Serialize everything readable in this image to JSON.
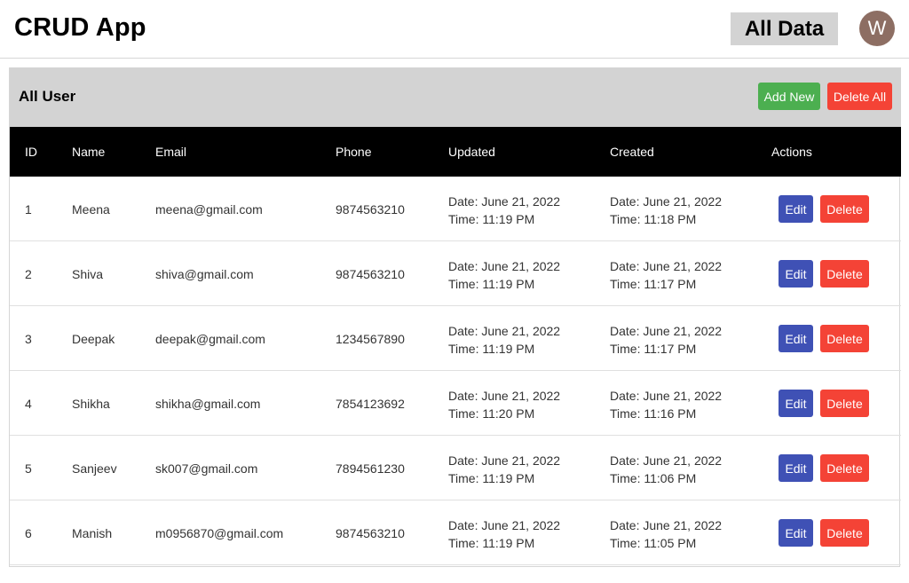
{
  "header": {
    "title": "CRUD App",
    "nav_link": "All Data",
    "avatar_letter": "W"
  },
  "panel": {
    "title": "All User",
    "add_label": "Add New",
    "delete_all_label": "Delete All"
  },
  "table": {
    "columns": [
      "ID",
      "Name",
      "Email",
      "Phone",
      "Updated",
      "Created",
      "Actions"
    ],
    "edit_label": "Edit",
    "delete_label": "Delete",
    "rows": [
      {
        "id": "1",
        "name": "Meena",
        "email": "meena@gmail.com",
        "phone": "9874563210",
        "updated_date": "Date: June 21, 2022",
        "updated_time": "Time: 11:19 PM",
        "created_date": "Date: June 21, 2022",
        "created_time": "Time: 11:18 PM"
      },
      {
        "id": "2",
        "name": "Shiva",
        "email": "shiva@gmail.com",
        "phone": "9874563210",
        "updated_date": "Date: June 21, 2022",
        "updated_time": "Time: 11:19 PM",
        "created_date": "Date: June 21, 2022",
        "created_time": "Time: 11:17 PM"
      },
      {
        "id": "3",
        "name": "Deepak",
        "email": "deepak@gmail.com",
        "phone": "1234567890",
        "updated_date": "Date: June 21, 2022",
        "updated_time": "Time: 11:19 PM",
        "created_date": "Date: June 21, 2022",
        "created_time": "Time: 11:17 PM"
      },
      {
        "id": "4",
        "name": "Shikha",
        "email": "shikha@gmail.com",
        "phone": "7854123692",
        "updated_date": "Date: June 21, 2022",
        "updated_time": "Time: 11:20 PM",
        "created_date": "Date: June 21, 2022",
        "created_time": "Time: 11:16 PM"
      },
      {
        "id": "5",
        "name": "Sanjeev",
        "email": "sk007@gmail.com",
        "phone": "7894561230",
        "updated_date": "Date: June 21, 2022",
        "updated_time": "Time: 11:19 PM",
        "created_date": "Date: June 21, 2022",
        "created_time": "Time: 11:06 PM"
      },
      {
        "id": "6",
        "name": "Manish",
        "email": "m0956870@gmail.com",
        "phone": "9874563210",
        "updated_date": "Date: June 21, 2022",
        "updated_time": "Time: 11:19 PM",
        "created_date": "Date: June 21, 2022",
        "created_time": "Time: 11:05 PM"
      }
    ]
  },
  "colors": {
    "add": "#4caf50",
    "delete": "#f44336",
    "edit": "#3f51b5",
    "header_bg": "#d3d3d3",
    "table_head_bg": "#000000",
    "avatar_bg": "#8d6e63"
  }
}
